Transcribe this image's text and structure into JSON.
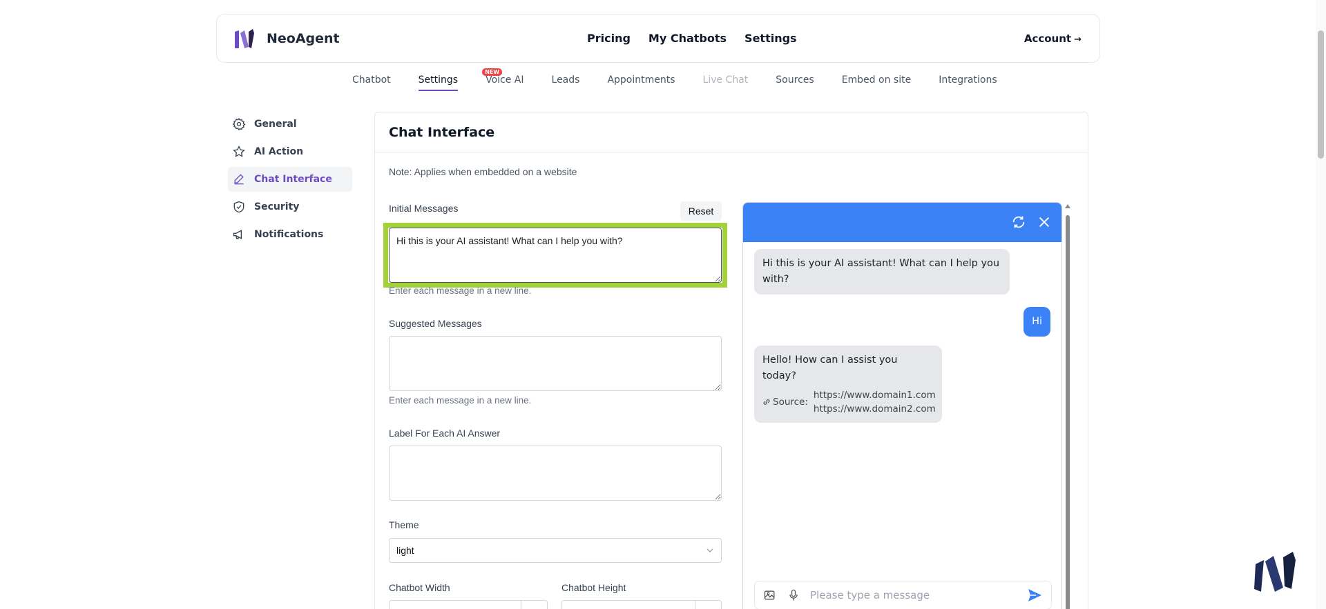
{
  "header": {
    "brand": "NeoAgent",
    "nav": [
      "Pricing",
      "My Chatbots",
      "Settings"
    ],
    "account": "Account",
    "account_arrow": "→"
  },
  "subtabs": [
    {
      "label": "Chatbot"
    },
    {
      "label": "Settings",
      "active": true
    },
    {
      "label": "Voice AI",
      "badge": "NEW"
    },
    {
      "label": "Leads"
    },
    {
      "label": "Appointments"
    },
    {
      "label": "Live Chat",
      "disabled": true
    },
    {
      "label": "Sources"
    },
    {
      "label": "Embed on site"
    },
    {
      "label": "Integrations"
    }
  ],
  "sidebar": {
    "items": [
      {
        "label": "General",
        "icon": "gear-icon"
      },
      {
        "label": "AI Action",
        "icon": "star-icon"
      },
      {
        "label": "Chat Interface",
        "icon": "pencil-icon",
        "active": true
      },
      {
        "label": "Security",
        "icon": "shield-icon"
      },
      {
        "label": "Notifications",
        "icon": "megaphone-icon"
      }
    ]
  },
  "panel": {
    "title": "Chat Interface",
    "note": "Note: Applies when embedded on a website",
    "initial_messages": {
      "label": "Initial Messages",
      "reset": "Reset",
      "value": "Hi this is your AI assistant! What can I help you with?",
      "hint": "Enter each message in a new line."
    },
    "suggested_messages": {
      "label": "Suggested Messages",
      "value": "",
      "hint": "Enter each message in a new line."
    },
    "ai_label": {
      "label": "Label For Each AI Answer",
      "value": ""
    },
    "theme": {
      "label": "Theme",
      "value": "light"
    },
    "chatbot_width": {
      "label": "Chatbot Width"
    },
    "chatbot_height": {
      "label": "Chatbot Height"
    }
  },
  "preview": {
    "header_color": "#3b82f6",
    "messages": [
      {
        "role": "bot",
        "text": "Hi this is your AI assistant! What can I help you with?"
      },
      {
        "role": "user",
        "text": "Hi"
      },
      {
        "role": "bot",
        "text": "Hello! How can I assist you today?",
        "source_label": "Source:",
        "sources": [
          "https://www.domain1.com",
          "https://www.domain2.com"
        ]
      }
    ],
    "input_placeholder": "Please type a message"
  },
  "colors": {
    "accent": "#6d4cc2",
    "focus_highlight": "#a3d13a",
    "chat_blue": "#3b82f6"
  }
}
